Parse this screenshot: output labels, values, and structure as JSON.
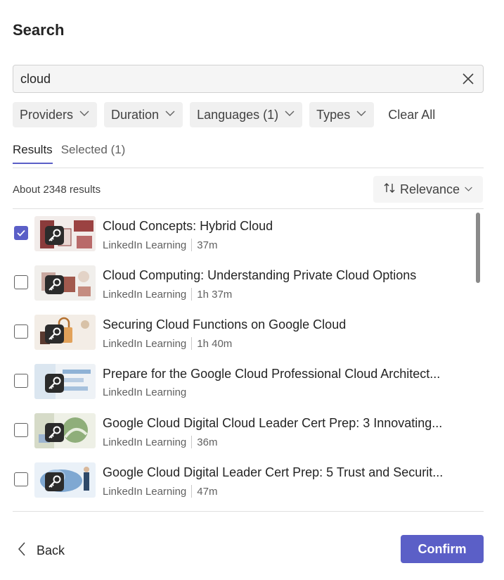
{
  "header": {
    "title": "Search"
  },
  "search": {
    "value": "cloud"
  },
  "filters": {
    "providers": "Providers",
    "duration": "Duration",
    "languages": "Languages (1)",
    "types": "Types",
    "clear_all": "Clear All"
  },
  "tabs": {
    "results": "Results",
    "selected": "Selected (1)"
  },
  "results": {
    "count": "About 2348 results",
    "sort_label": "Relevance",
    "items": [
      {
        "title": "Cloud Concepts: Hybrid Cloud",
        "provider": "LinkedIn Learning",
        "duration": "37m",
        "checked": true
      },
      {
        "title": "Cloud Computing: Understanding Private Cloud Options",
        "provider": "LinkedIn Learning",
        "duration": "1h 37m",
        "checked": false
      },
      {
        "title": "Securing Cloud Functions on Google Cloud",
        "provider": "LinkedIn Learning",
        "duration": "1h 40m",
        "checked": false
      },
      {
        "title": "Prepare for the Google Cloud Professional Cloud Architect...",
        "provider": "LinkedIn Learning",
        "duration": "",
        "checked": false
      },
      {
        "title": "Google Cloud Digital Cloud Leader Cert Prep: 3 Innovating...",
        "provider": "LinkedIn Learning",
        "duration": "36m",
        "checked": false
      },
      {
        "title": "Google Cloud Digital Leader Cert Prep: 5 Trust and Securit...",
        "provider": "LinkedIn Learning",
        "duration": "47m",
        "checked": false
      }
    ]
  },
  "footer": {
    "back": "Back",
    "confirm": "Confirm"
  },
  "colors": {
    "accent": "#5b5fc7",
    "text": "#242424",
    "muted": "#616161"
  },
  "icons": {
    "clear": "close-icon",
    "chevron": "chevron-down-icon",
    "sort": "sort-arrows-icon",
    "key": "key-icon",
    "back": "chevron-left-icon",
    "check": "checkmark-icon"
  }
}
